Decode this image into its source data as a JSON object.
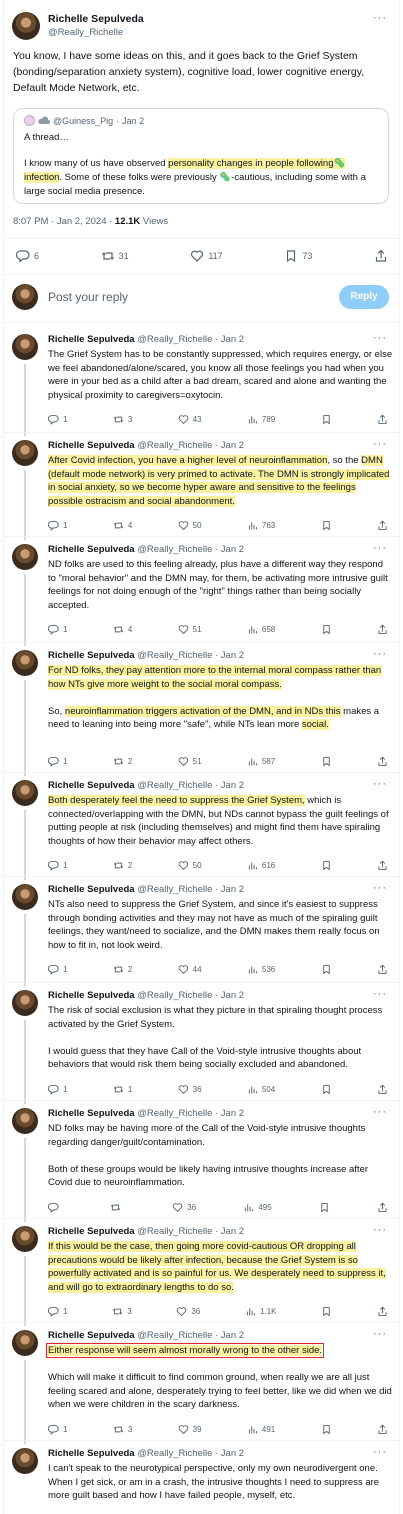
{
  "main": {
    "author_name": "Richelle Sepulveda",
    "author_handle": "@Really_Richelle",
    "text": "You know, I have some ideas on this, and it goes back to the Grief System (bonding/separation anxiety system), cognitive load, lower cognitive energy, Default Mode Network, etc.",
    "quote": {
      "author_handle": "@Guiness_Pig",
      "date": "Jan 2",
      "line1": "A thread…",
      "body_pre": "I know many of us have observed ",
      "body_hl1": "personality changes in people following",
      "body_hl2": " infection",
      "body_post": ". Some of these folks were previously ",
      "body_end": "-cautious, including some with a large social media presence."
    },
    "time": "8:07 PM · Jan 2, 2024 · ",
    "views_count": "12.1K",
    "views_label": " Views",
    "stats": {
      "replies": "6",
      "reposts": "31",
      "likes": "117",
      "bookmarks": "73"
    }
  },
  "reply_box": {
    "placeholder": "Post your reply",
    "button": "Reply"
  },
  "replies": [
    {
      "name": "Richelle Sepulveda",
      "meta": "@Really_Richelle · Jan 2",
      "paras": [
        [
          "The Grief System has to be constantly suppressed, which requires energy, or else we feel abandoned/alone/scared, you know all those feelings you had when you were in your bed as a child after a bad dream, scared and alone and wanting the physical proximity to caregivers=oxytocin."
        ]
      ],
      "stats": [
        "1",
        "3",
        "43",
        "789"
      ]
    },
    {
      "name": "Richelle Sepulveda",
      "meta": "@Really_Richelle · Jan 2",
      "paras": [
        [
          "",
          "After Covid infection, you have a higher level of neuroinflammation",
          ", so the ",
          "DMN (default mode network) is very primed to activate. The DMN is strongly implicated in social anxiety, so we become hyper aware and sensitive to the feelings possible ostracism and social abandonment."
        ]
      ],
      "stats": [
        "1",
        "4",
        "50",
        "763"
      ]
    },
    {
      "name": "Richelle Sepulveda",
      "meta": "@Really_Richelle · Jan 2",
      "paras": [
        [
          "ND folks are used to this feeling already, plus have a different way they respond to \"moral behavior\" and the DMN may, for them, be activating more intrusive guilt feelings for not doing enough of the \"right\" things rather than being socially accepted."
        ]
      ],
      "stats": [
        "1",
        "4",
        "51",
        "658"
      ]
    },
    {
      "name": "Richelle Sepulveda",
      "meta": "@Really_Richelle · Jan 2",
      "paras": [
        [
          "",
          "For ND folks, they pay attention more to the internal moral compass rather than how NTs give more weight to the social moral compass."
        ],
        [
          "So, ",
          "neuroinflammation triggers activation of the DMN, and in NDs this",
          " makes a need to leaning into being more \"safe\", while NTs lean more ",
          "social."
        ]
      ],
      "stats": [
        "1",
        "2",
        "51",
        "587"
      ]
    },
    {
      "name": "Richelle Sepulveda",
      "meta": "@Really_Richelle · Jan 2",
      "paras": [
        [
          "",
          "Both desperately feel the need to suppress the Grief System,",
          " which is connected/overlapping with the DMN, but NDs cannot bypass the guilt feelings of putting people at risk (including themselves) and might find them have spiraling thoughts of how their behavior may affect others."
        ]
      ],
      "stats": [
        "1",
        "2",
        "50",
        "616"
      ]
    },
    {
      "name": "Richelle Sepulveda",
      "meta": "@Really_Richelle · Jan 2",
      "paras": [
        [
          "NTs also need to suppress the Grief System, and since it's easiest to suppress through bonding activities and they may not have as much of the spiraling guilt feelings, they want/need to socialize, and the DMN makes them really focus on how to fit in, not look weird."
        ]
      ],
      "stats": [
        "1",
        "2",
        "44",
        "536"
      ]
    },
    {
      "name": "Richelle Sepulveda",
      "meta": "@Really_Richelle · Jan 2",
      "paras": [
        [
          "The risk of social exclusion is what they picture in that spiraling thought process activated by the Grief System."
        ],
        [
          "I would guess that they have Call of the Void-style intrusive thoughts about behaviors that would risk them being socially excluded and abandoned."
        ]
      ],
      "stats": [
        "1",
        "1",
        "36",
        "504"
      ]
    },
    {
      "name": "Richelle Sepulveda",
      "meta": "@Really_Richelle · Jan 2",
      "paras": [
        [
          "ND folks may be having more of the Call of the Void-style intrusive thoughts regarding danger/guilt/contamination."
        ],
        [
          "Both of these groups would be likely having intrusive thoughts increase after Covid due to neuroinflammation."
        ]
      ],
      "stats": [
        "",
        "",
        "36",
        "495"
      ]
    },
    {
      "name": "Richelle Sepulveda",
      "meta": "@Really_Richelle · Jan 2",
      "paras": [
        [
          "",
          "If this would be the case, then going more covid-cautious OR dropping all precautions would be likely after infection, because the Grief System is so powerfully activated and is so painful for us. We desperately need to suppress it, and will go to extraordinary lengths to do so."
        ]
      ],
      "stats": [
        "1",
        "3",
        "36",
        "1.1K"
      ]
    },
    {
      "name": "Richelle Sepulveda",
      "meta": "@Really_Richelle · Jan 2",
      "paras": [
        [
          "",
          "Either response will seem almost morally wrong to the other side."
        ],
        [
          "Which will make it difficult to find common ground, when really we are all just feeling scared and alone, desperately trying to feel better, like we did when we did when we were children in the scary darkness."
        ]
      ],
      "stats": [
        "1",
        "3",
        "39",
        "491"
      ]
    },
    {
      "name": "Richelle Sepulveda",
      "meta": "@Really_Richelle · Jan 2",
      "paras": [
        [
          "I can't speak to the neurotypical perspective, only my own neurodivergent one. When I get sick, or am in a crash, the intrusive thoughts I need to suppress are more guilt based and how I have failed people, myself, etc."
        ]
      ],
      "stats": []
    }
  ],
  "icons": [
    "more-icon",
    "reply-icon",
    "repost-icon",
    "like-icon",
    "views-icon",
    "bookmark-icon",
    "share-icon",
    "microbe-icon"
  ],
  "colors": {
    "highlight": "#fbf2a0",
    "reply_button": "#8ecdf8",
    "box_outline": "#e0282e",
    "muted_text": "#536471"
  }
}
